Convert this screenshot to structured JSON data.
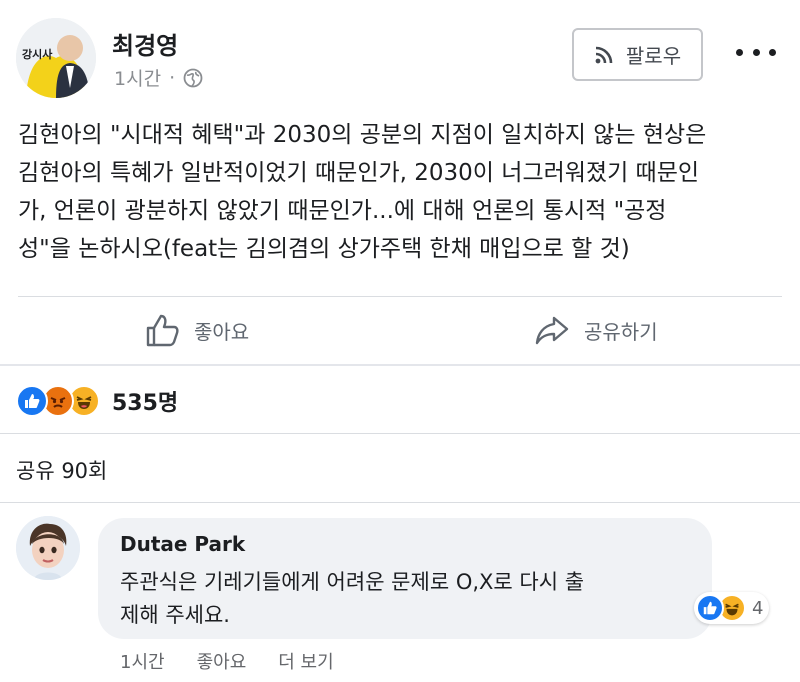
{
  "post": {
    "author": "최경영",
    "avatar_badge": "강시사",
    "time": "1시간",
    "separator": "·",
    "follow_label": "팔로우",
    "text": "김현아의 \"시대적 혜택\"과 2030의 공분의 지점이 일치하지 않는 현상은\n김현아의 특혜가 일반적이었기 때문인가, 2030이 너그러워졌기 때문인\n가, 언론이 광분하지 않았기 때문인가...에 대해 언론의 통시적 \"공정\n성\"을 논하시오(feat는 김의겸의 상가주택 한채 매입으로 할 것)"
  },
  "actions": {
    "like_label": "좋아요",
    "share_label": "공유하기"
  },
  "reactions": {
    "icons": [
      "like-icon",
      "angry-icon",
      "haha-icon"
    ],
    "count": "535명"
  },
  "shares": {
    "label": "공유 90회"
  },
  "comment": {
    "author": "Dutae Park",
    "text": "주관식은 기레기들에게 어려운 문제로 O,X로 다시 출\n제해 주세요.",
    "reaction_count": "4",
    "time": "1시간",
    "like_label": "좋아요",
    "more_label": "더 보기"
  },
  "colors": {
    "like_blue": "#1877f2",
    "angry_orange": "#e9710f",
    "haha_yellow": "#f7b125",
    "muted_text": "#65676b",
    "bubble_bg": "#f0f2f5"
  }
}
